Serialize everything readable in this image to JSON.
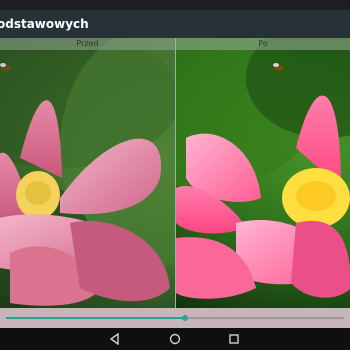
{
  "app": {
    "title": "odstawowych"
  },
  "compare": {
    "before_label": "Przed",
    "after_label": "Po"
  },
  "seekbar": {
    "progress_fraction": 0.53,
    "accent": "#26a69a"
  },
  "nav": {
    "icons": [
      "back-icon",
      "home-icon",
      "recents-icon"
    ]
  },
  "colors": {
    "app_bar": "#263238",
    "status_bar": "#1c1f22",
    "nav_bar": "#0f0f0f"
  }
}
